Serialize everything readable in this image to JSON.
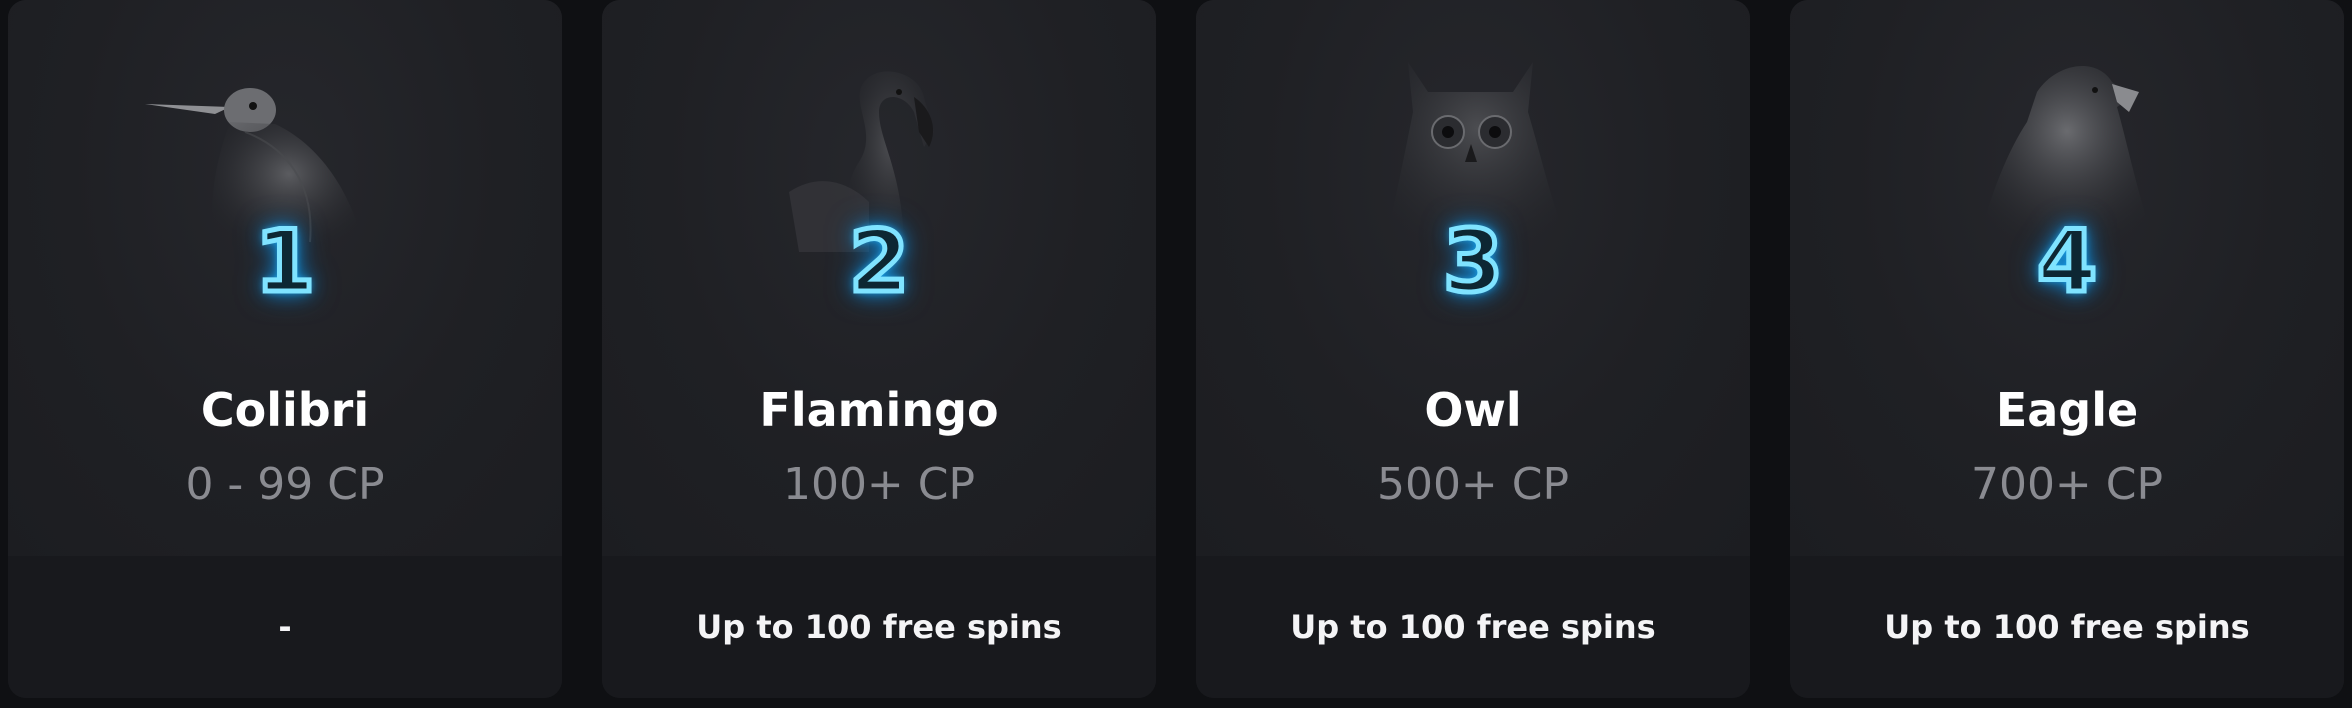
{
  "levels": [
    {
      "number": "1",
      "name": "Colibri",
      "range": "0 - 99 CP",
      "reward": "-",
      "bird_icon": "hummingbird-icon"
    },
    {
      "number": "2",
      "name": "Flamingo",
      "range": "100+ CP",
      "reward": "Up to 100 free spins",
      "bird_icon": "flamingo-icon"
    },
    {
      "number": "3",
      "name": "Owl",
      "range": "500+ CP",
      "reward": "Up to 100 free spins",
      "bird_icon": "owl-icon"
    },
    {
      "number": "4",
      "name": "Eagle",
      "range": "700+ CP",
      "reward": "Up to 100 free spins",
      "bird_icon": "eagle-icon"
    }
  ],
  "colors": {
    "background": "#0f1013",
    "card": "#1c1d21",
    "card_footer": "#18191d",
    "neon_blue": "#1fb6ff",
    "range_gray": "#8a8b91"
  }
}
